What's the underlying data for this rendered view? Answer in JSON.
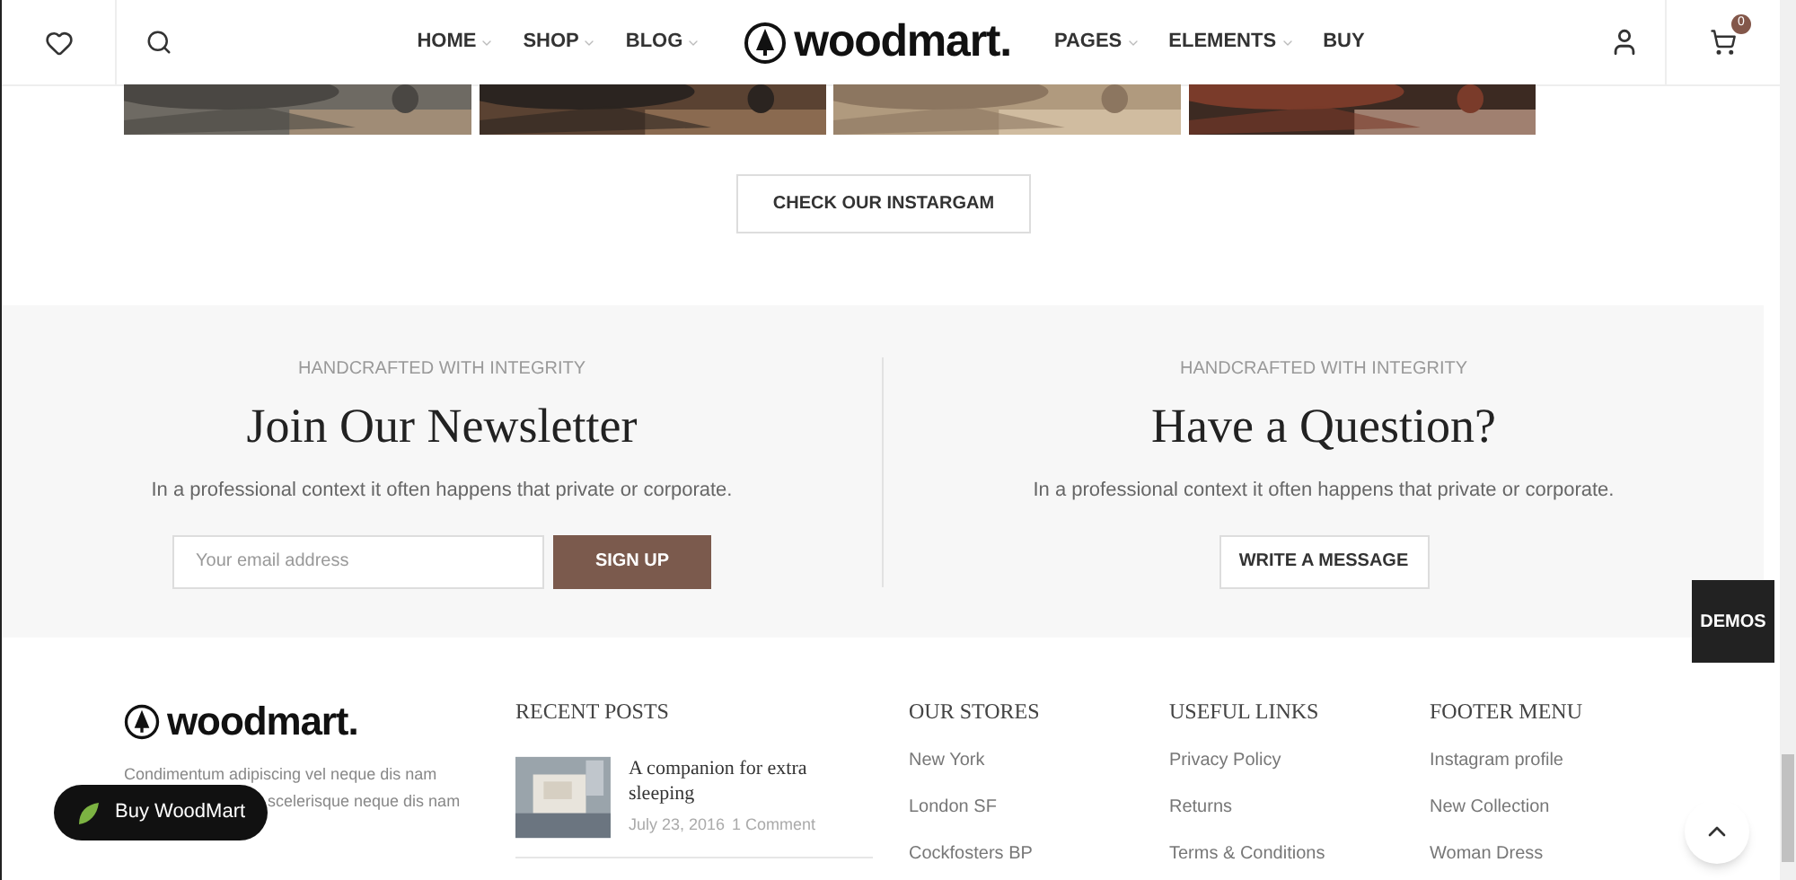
{
  "header": {
    "nav_left": [
      {
        "label": "HOME",
        "dropdown": true
      },
      {
        "label": "SHOP",
        "dropdown": true
      },
      {
        "label": "BLOG",
        "dropdown": true
      }
    ],
    "logo": "woodmart.",
    "nav_right": [
      {
        "label": "PAGES",
        "dropdown": true
      },
      {
        "label": "ELEMENTS",
        "dropdown": true
      },
      {
        "label": "BUY",
        "dropdown": false
      }
    ],
    "cart_count": "0"
  },
  "instagram": {
    "button": "CHECK OUR INSTARGAM"
  },
  "newsletter": {
    "eyebrow": "HANDCRAFTED WITH INTEGRITY",
    "title": "Join Our Newsletter",
    "text": "In a professional context it often happens that private or corporate.",
    "placeholder": "Your email address",
    "button": "SIGN UP"
  },
  "question": {
    "eyebrow": "HANDCRAFTED WITH INTEGRITY",
    "title": "Have a Question?",
    "text": "In a professional context it often happens that private or corporate.",
    "button": "WRITE A MESSAGE"
  },
  "demos": {
    "label": "DEMOS"
  },
  "footer": {
    "logo": "woodmart.",
    "text_line_1": "Condimentum adipiscing vel neque dis nam",
    "text_line_2": "scelerisque neque dis nam",
    "buy_button": "Buy WoodMart",
    "recent_posts": {
      "title": "RECENT POSTS",
      "posts": [
        {
          "title": "A companion for extra sleeping",
          "date": "July 23, 2016",
          "comments": "1 Comment"
        }
      ]
    },
    "columns": [
      {
        "title": "OUR STORES",
        "links": [
          "New York",
          "London SF",
          "Cockfosters BP"
        ]
      },
      {
        "title": "USEFUL LINKS",
        "links": [
          "Privacy Policy",
          "Returns",
          "Terms & Conditions"
        ]
      },
      {
        "title": "FOOTER MENU",
        "links": [
          "Instagram profile",
          "New Collection",
          "Woman Dress"
        ]
      }
    ]
  }
}
